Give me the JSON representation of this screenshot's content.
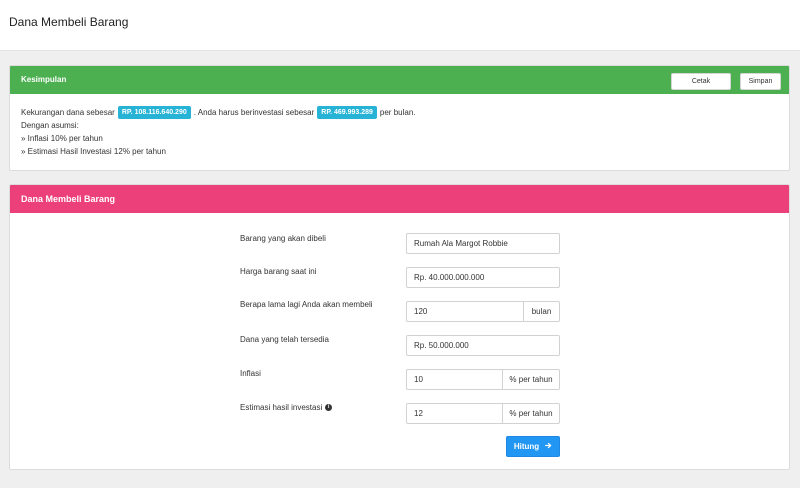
{
  "page": {
    "title": "Dana Membeli Barang"
  },
  "summary": {
    "title": "Kesimpulan",
    "print_label": "Cetak",
    "save_label": "Simpan",
    "line1_prefix": "Kekurangan dana sebesar",
    "shortfall": "RP. 108.116.640.290",
    "line1_middle": ". Anda harus berinvestasi sebesar",
    "monthly_investment": "RP. 469.993.289",
    "line1_suffix": "per bulan.",
    "assumptions_title": "Dengan asumsi:",
    "assumptions": [
      "» Inflasi 10% per tahun",
      "» Estimasi Hasil Investasi 12% per tahun"
    ]
  },
  "form": {
    "title": "Dana Membeli Barang",
    "item_label": "Barang yang akan dibeli",
    "item_value": "Rumah Ala Margot Robbie",
    "price_label": "Harga barang saat ini",
    "price_value": "Rp. 40.000.000.000",
    "duration_label": "Berapa lama lagi Anda akan membeli",
    "duration_value": "120",
    "duration_unit": "bulan",
    "funds_label": "Dana yang telah tersedia",
    "funds_value": "Rp. 50.000.000",
    "inflation_label": "Inflasi",
    "inflation_value": "10",
    "inflation_unit": "% per tahun",
    "return_label": "Estimasi hasil investasi",
    "return_value": "12",
    "return_unit": "% per tahun",
    "submit_label": "Hitung",
    "submit_icon": "arrow-right-icon",
    "info_icon": "info-circle-icon"
  },
  "colors": {
    "summary_header": "#4caf50",
    "form_header": "#ec407a",
    "badge": "#26b3d6",
    "primary_button": "#2196f3"
  }
}
